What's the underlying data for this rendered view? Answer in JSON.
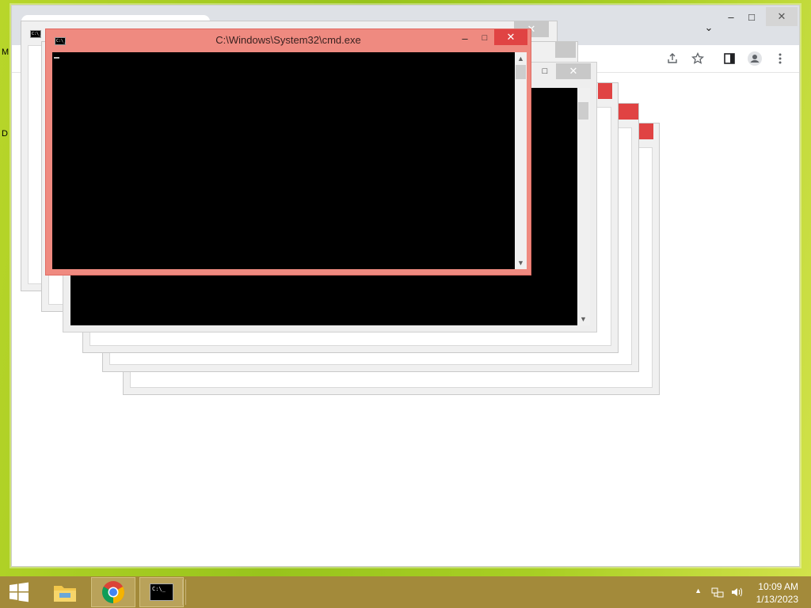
{
  "desktop": {
    "labels": [
      "M",
      "D"
    ]
  },
  "browser": {
    "name": "Google Chrome",
    "minimize": "–",
    "maximize": "□",
    "close": "✕",
    "tab_search": "⌄",
    "toolbar_icons": [
      "share-icon",
      "bookmark-star-icon",
      "side-panel-icon",
      "profile-icon",
      "more-menu-icon"
    ]
  },
  "cmd_front": {
    "title": "C:\\Windows\\System32\\cmd.exe",
    "minimize": "–",
    "maximize": "□",
    "close": "✕"
  },
  "cmd_back": {
    "maximize": "□",
    "close": "✕"
  },
  "ghost_dialogs": {
    "close": "✕"
  },
  "taskbar": {
    "apps": [
      "File Explorer",
      "Google Chrome",
      "Command Prompt"
    ],
    "time": "10:09 AM",
    "date": "1/13/2023",
    "tray_icons": [
      "show-hidden-icons-arrow",
      "network-icon",
      "volume-icon"
    ]
  },
  "colors": {
    "cmd_active_frame": "#ef8a80",
    "close_red": "#e04343",
    "taskbar": "#a38a3a",
    "desktop": "#a9cf24"
  }
}
